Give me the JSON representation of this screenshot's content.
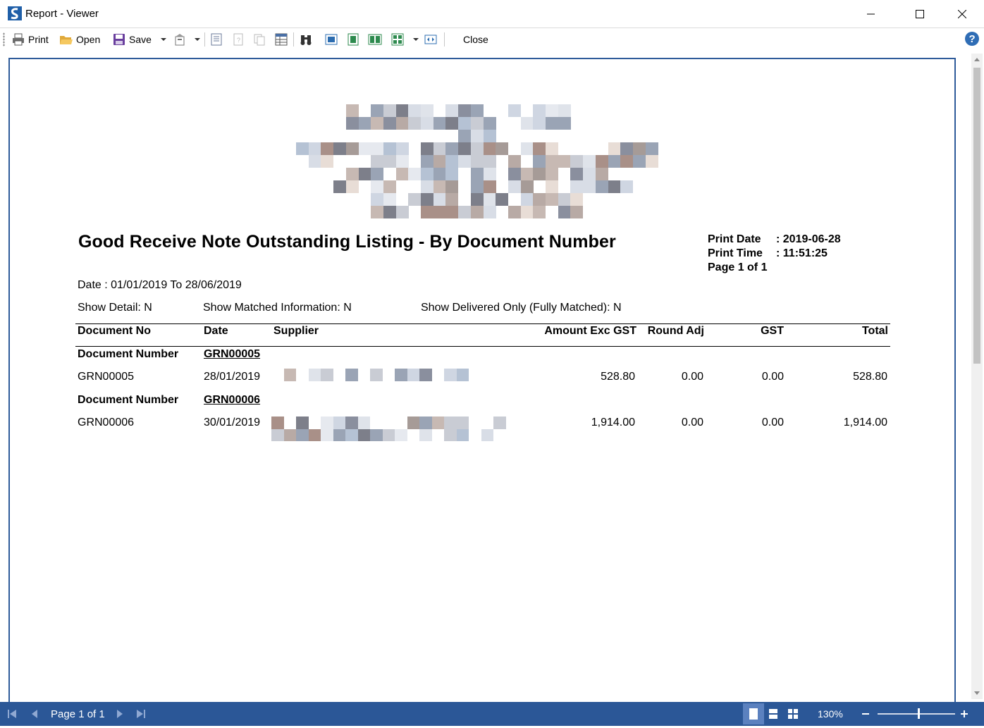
{
  "window": {
    "title": "Report - Viewer",
    "icons": [
      "app-logo-icon",
      "minimize-icon",
      "maximize-icon",
      "close-icon"
    ]
  },
  "toolbar": {
    "print_label": "Print",
    "open_label": "Open",
    "save_label": "Save",
    "close_label": "Close",
    "icons": [
      "printer-icon",
      "folder-open-icon",
      "save-disk-icon",
      "export-icon",
      "page-setup-icon",
      "bookmark-icon",
      "copy-icon",
      "table-icon",
      "find-binoculars-icon",
      "view-page-icon",
      "view-width-icon",
      "two-pages-icon",
      "multi-page-icon",
      "fit-icon",
      "help-icon"
    ]
  },
  "report": {
    "title": "Good Receive Note Outstanding Listing - By Document Number",
    "print_date_label": "Print Date",
    "print_date_value": ": 2019-06-28",
    "print_time_label": "Print Time",
    "print_time_value": ": 11:51:25",
    "page_label": "Page 1 of 1",
    "date_range": "Date : 01/01/2019 To 28/06/2019",
    "filters": {
      "show_detail": "Show Detail: N",
      "show_matched": "Show Matched Information: N",
      "show_delivered": "Show Delivered Only (Fully Matched): N"
    },
    "columns": {
      "doc_no": "Document No",
      "date": "Date",
      "supplier": "Supplier",
      "amount": "Amount Exc GST",
      "round_adj": "Round Adj",
      "gst": "GST",
      "total": "Total"
    },
    "groups": [
      {
        "label": "Document Number",
        "value": "GRN00005",
        "row": {
          "doc_no": "GRN00005",
          "date": "28/01/2019",
          "amount": "528.80",
          "round_adj": "0.00",
          "gst": "0.00",
          "total": "528.80"
        }
      },
      {
        "label": "Document Number",
        "value": "GRN00006",
        "row": {
          "doc_no": "GRN00006",
          "date": "30/01/2019",
          "amount": "1,914.00",
          "round_adj": "0.00",
          "gst": "0.00",
          "total": "1,914.00"
        }
      }
    ]
  },
  "statusbar": {
    "page_info": "Page 1 of 1",
    "zoom": "130%",
    "icons": [
      "first-page-icon",
      "prev-page-icon",
      "next-page-icon",
      "last-page-icon",
      "single-page-view-icon",
      "continuous-view-icon",
      "multi-page-view-icon",
      "zoom-out-icon",
      "zoom-in-icon"
    ]
  }
}
